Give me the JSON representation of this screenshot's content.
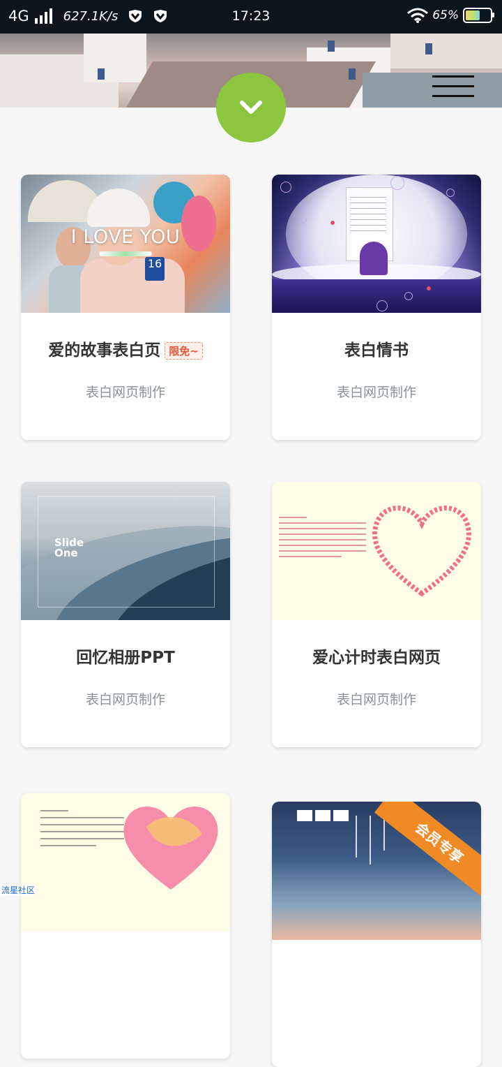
{
  "status_bar": {
    "network": "4G",
    "speed": "627.1K/s",
    "time": "17:23",
    "battery": "65%",
    "battery_level": 0.65
  },
  "cards": [
    {
      "title": "爱的故事表白页",
      "tag": "限免~",
      "subtitle": "表白网页制作",
      "thumb_text": "I LOVE YOU",
      "thumb_badge": "16"
    },
    {
      "title": "表白情书",
      "subtitle": "表白网页制作"
    },
    {
      "title": "回忆相册PPT",
      "subtitle": "表白网页制作",
      "thumb_text": "Slide One"
    },
    {
      "title": "爱心计时表白网页",
      "subtitle": "表白网页制作"
    },
    {
      "title": "",
      "subtitle": ""
    },
    {
      "title": "",
      "subtitle": "",
      "thumb_ribbon": "会员专享"
    }
  ],
  "watermark": "流星社区",
  "colors": {
    "accent_green": "#8cc63f",
    "status_bar_bg": "#0c141c",
    "page_bg": "#f7f7f7"
  },
  "icons": {
    "fab": "chevron-down-icon",
    "menu": "hamburger-menu-icon"
  }
}
